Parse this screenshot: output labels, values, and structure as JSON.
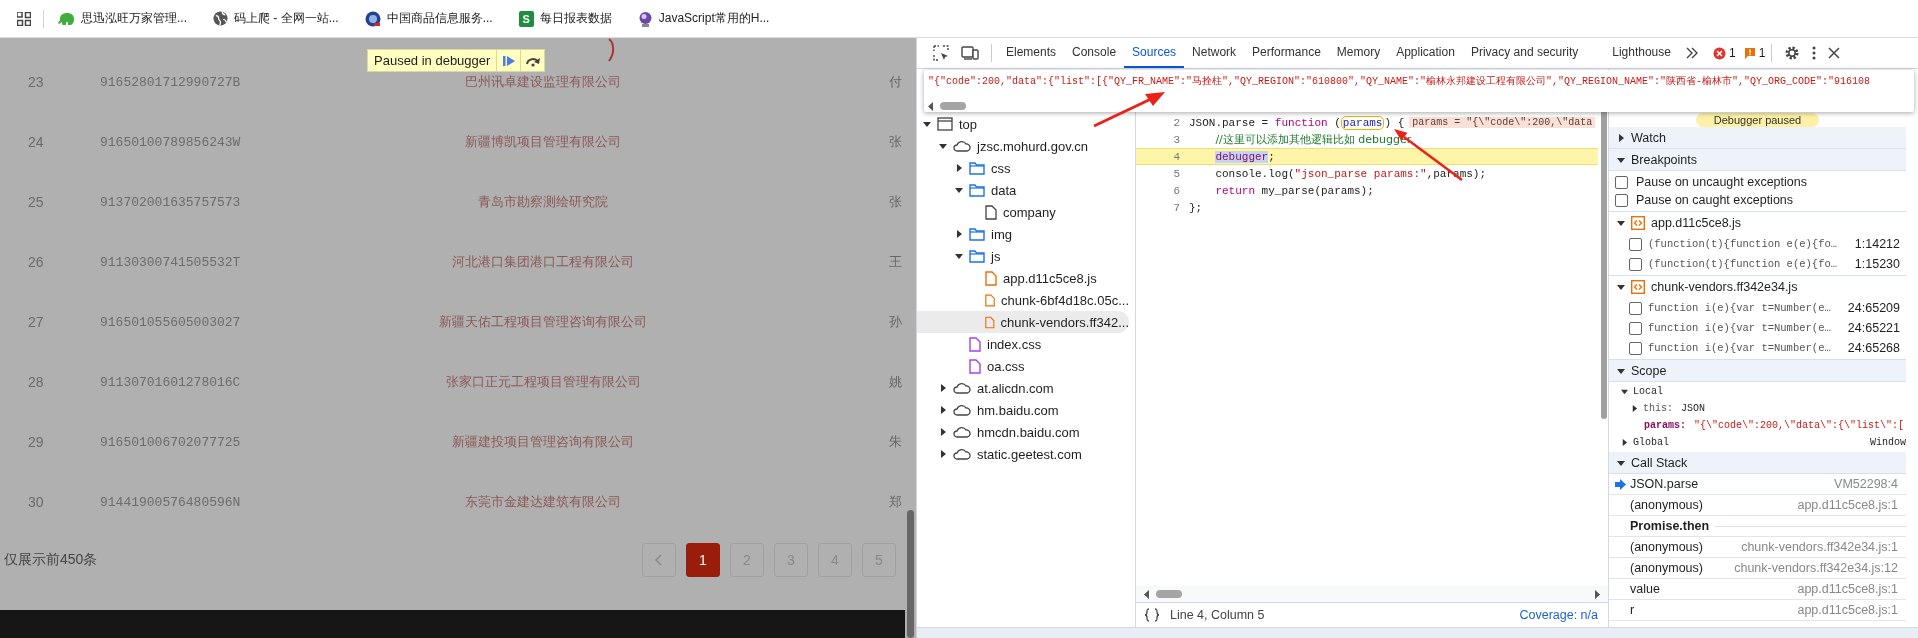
{
  "bookmarks": [
    {
      "label": "思迅泓旺万家管理...",
      "kind": "elephant"
    },
    {
      "label": "码上爬 - 全网一站...",
      "kind": "globe"
    },
    {
      "label": "中国商品信息服务...",
      "kind": "seal"
    },
    {
      "label": "每日报表数据",
      "kind": "sheet",
      "badge": "S"
    },
    {
      "label": "JavaScript常用的H...",
      "kind": "orb"
    }
  ],
  "debugger_banner": {
    "label": "Paused in debugger"
  },
  "company_table": {
    "rows": [
      {
        "index": "23",
        "code": "91652801712990727B",
        "name": "巴州讯卓建设监理有限公司",
        "column_4": "付"
      },
      {
        "index": "24",
        "code": "91650100789856243W",
        "name": "新疆博凯项目管理有限公司",
        "column_4": "张"
      },
      {
        "index": "25",
        "code": "913702001635757573",
        "name": "青岛市勘察测绘研究院",
        "column_4": "张"
      },
      {
        "index": "26",
        "code": "91130300741505532T",
        "name": "河北港口集团港口工程有限公司",
        "column_4": "王"
      },
      {
        "index": "27",
        "code": "916501055605003027",
        "name": "新疆天佑工程项目管理咨询有限公司",
        "column_4": "孙"
      },
      {
        "index": "28",
        "code": "91130701601278016C",
        "name": "张家口正元工程项目管理有限公司",
        "column_4": "姚"
      },
      {
        "index": "29",
        "code": "916501006702077725",
        "name": "新疆建投项目管理咨询有限公司",
        "column_4": "朱"
      },
      {
        "index": "30",
        "code": "91441900576480596N",
        "name": "东莞市金建达建筑有限公司",
        "column_4": "郑"
      }
    ],
    "note": "仅展示前450条",
    "pages": [
      {
        "label": "1",
        "selected": true
      },
      {
        "label": "2",
        "selected": false
      },
      {
        "label": "3",
        "selected": false
      },
      {
        "label": "4",
        "selected": false
      },
      {
        "label": "5",
        "selected": false
      }
    ]
  },
  "devtools": {
    "tabs": [
      {
        "label": "Elements",
        "selected": false
      },
      {
        "label": "Console",
        "selected": false
      },
      {
        "label": "Sources",
        "selected": true
      },
      {
        "label": "Network",
        "selected": false
      },
      {
        "label": "Performance",
        "selected": false
      },
      {
        "label": "Memory",
        "selected": false
      },
      {
        "label": "Application",
        "selected": false
      },
      {
        "label": "Privacy and security",
        "selected": false
      },
      {
        "label": "Lighthouse",
        "selected": false
      }
    ],
    "error_count": "1",
    "warning_count": "1",
    "hover_value": "\"{\"code\":200,\"data\":{\"list\":[{\"QY_FR_NAME\":\"马拴柱\",\"QY_REGION\":\"610800\",\"QY_NAME\":\"榆林永邦建设工程有限公司\",\"QY_REGION_NAME\":\"陕西省-榆林市\",\"QY_ORG_CODE\":\"916108",
    "tree": [
      {
        "label": "top",
        "kind": "frame",
        "expanded": true,
        "selected": false,
        "children": [
          {
            "label": "jzsc.mohurd.gov.cn",
            "kind": "domain",
            "expanded": true,
            "selected": false,
            "children": [
              {
                "label": "css",
                "kind": "folder",
                "expanded": false,
                "selected": false
              },
              {
                "label": "data",
                "kind": "folder",
                "expanded": true,
                "selected": false,
                "children": [
                  {
                    "label": "company",
                    "kind": "file",
                    "selected": false
                  }
                ]
              },
              {
                "label": "img",
                "kind": "folder",
                "expanded": false,
                "selected": false
              },
              {
                "label": "js",
                "kind": "folder",
                "expanded": true,
                "selected": false,
                "children": [
                  {
                    "label": "app.d11c5ce8.js",
                    "kind": "script",
                    "selected": false
                  },
                  {
                    "label": "chunk-6bf4d18c.05c...",
                    "kind": "script",
                    "selected": false
                  },
                  {
                    "label": "chunk-vendors.ff342...",
                    "kind": "script",
                    "selected": true
                  }
                ]
              },
              {
                "label": "index.css",
                "kind": "style",
                "selected": false
              },
              {
                "label": "oa.css",
                "kind": "style",
                "selected": false
              }
            ]
          },
          {
            "label": "at.alicdn.com",
            "kind": "domain",
            "expanded": false,
            "selected": false
          },
          {
            "label": "hm.baidu.com",
            "kind": "domain",
            "expanded": false,
            "selected": false
          },
          {
            "label": "hmcdn.baidu.com",
            "kind": "domain",
            "expanded": false,
            "selected": false
          },
          {
            "label": "static.geetest.com",
            "kind": "domain",
            "expanded": false,
            "selected": false
          }
        ]
      }
    ],
    "code_lines": [
      {
        "number": "2",
        "highlighted": false,
        "indented": false,
        "tokens": [
          {
            "text": "JSON.parse = ",
            "kind": "plain"
          },
          {
            "text": "function",
            "kind": "keyword"
          },
          {
            "text": " (",
            "kind": "plain"
          },
          {
            "text": "params",
            "kind": "param"
          },
          {
            "text": ") {",
            "kind": "plain"
          },
          {
            "text": "params = \"{\\\"code\\\":200,\\\"data",
            "kind": "inline_value"
          }
        ]
      },
      {
        "number": "3",
        "highlighted": false,
        "indented": true,
        "tokens": [
          {
            "text": "//这里可以添加其他逻辑比如 debugger",
            "kind": "comment"
          }
        ]
      },
      {
        "number": "4",
        "highlighted": true,
        "indented": true,
        "tokens": [
          {
            "text": "debugger",
            "kind": "paused"
          },
          {
            "text": ";",
            "kind": "plain"
          }
        ]
      },
      {
        "number": "5",
        "highlighted": false,
        "indented": true,
        "tokens": [
          {
            "text": "console.log(",
            "kind": "plain"
          },
          {
            "text": "\"json_parse params:\"",
            "kind": "string"
          },
          {
            "text": ",params);",
            "kind": "plain"
          }
        ]
      },
      {
        "number": "6",
        "highlighted": false,
        "indented": true,
        "tokens": [
          {
            "text": "return",
            "kind": "keyword"
          },
          {
            "text": " my_parse(params);",
            "kind": "plain"
          }
        ]
      },
      {
        "number": "7",
        "highlighted": false,
        "indented": false,
        "tokens": [
          {
            "text": "};",
            "kind": "plain"
          }
        ]
      }
    ],
    "status": {
      "position": "Line 4, Column 5",
      "coverage": "Coverage: n/a"
    },
    "sidebar": {
      "paused_label": "Debugger paused",
      "watch": {
        "label": "Watch",
        "expanded": false
      },
      "breakpoints": {
        "label": "Breakpoints",
        "expanded": true,
        "options": [
          {
            "label": "Pause on uncaught exceptions",
            "checked": false
          },
          {
            "label": "Pause on caught exceptions",
            "checked": false
          }
        ],
        "files": [
          {
            "file": "app.d11c5ce8.js",
            "expanded": true,
            "items": [
              {
                "code": "(function(t){function e(e){fo…",
                "location": "1:14212",
                "checked": false
              },
              {
                "code": "(function(t){function e(e){fo…",
                "location": "1:15230",
                "checked": false
              }
            ]
          },
          {
            "file": "chunk-vendors.ff342e34.js",
            "expanded": true,
            "items": [
              {
                "code": "function i(e){var t=Number(e…",
                "location": "24:65209",
                "checked": false
              },
              {
                "code": "function i(e){var t=Number(e…",
                "location": "24:65221",
                "checked": false
              },
              {
                "code": "function i(e){var t=Number(e…",
                "location": "24:65268",
                "checked": false
              }
            ]
          }
        ]
      },
      "scope": {
        "label": "Scope",
        "expanded": true,
        "groups": [
          {
            "label": "Local",
            "expanded": true,
            "entries": [
              {
                "key": "this:",
                "value": "JSON",
                "kind": "object"
              },
              {
                "key": "params:",
                "value": "\"{\\\"code\\\":200,\\\"data\\\":{\\\"list\\\":[",
                "kind": "string"
              }
            ]
          },
          {
            "label": "Global",
            "expanded": false,
            "value": "Window"
          }
        ]
      },
      "call_stack": {
        "label": "Call Stack",
        "expanded": true,
        "frames": [
          {
            "kind": "frame",
            "name": "JSON.parse",
            "location": "VM52298:4",
            "current": true
          },
          {
            "kind": "frame",
            "name": "(anonymous)",
            "location": "app.d11c5ce8.js:1",
            "current": false
          },
          {
            "kind": "async",
            "name": "Promise.then"
          },
          {
            "kind": "frame",
            "name": "(anonymous)",
            "location": "chunk-vendors.ff342e34.js:1",
            "current": false
          },
          {
            "kind": "frame",
            "name": "(anonymous)",
            "location": "chunk-vendors.ff342e34.js:12",
            "current": false
          },
          {
            "kind": "frame",
            "name": "value",
            "location": "app.d11c5ce8.js:1",
            "current": false
          },
          {
            "kind": "frame",
            "name": "r",
            "location": "app.d11c5ce8.js:1",
            "current": false
          }
        ]
      }
    }
  }
}
